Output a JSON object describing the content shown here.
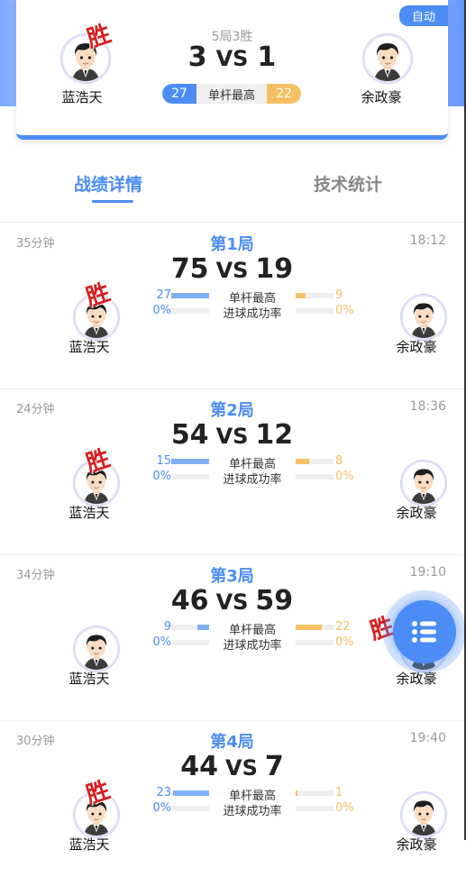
{
  "summary": {
    "auto_label": "自动",
    "rule": "5局3胜",
    "score_left": "3",
    "vs": "VS",
    "score_right": "1",
    "stat_left": "27",
    "stat_label": "单杆最高",
    "stat_right": "22",
    "player_left": "蓝浩天",
    "player_right": "余政豪",
    "win_label": "胜"
  },
  "tabs": [
    {
      "label": "战绩详情",
      "active": true
    },
    {
      "label": "技术统计",
      "active": false
    }
  ],
  "labels": {
    "high_break": "单杆最高",
    "pot_rate": "进球成功率",
    "win": "胜",
    "vs": "VS"
  },
  "games": [
    {
      "duration": "35分钟",
      "title": "第1局",
      "time": "18:12",
      "score_left": "75",
      "score_right": "19",
      "hb_left": "27",
      "hb_right": "9",
      "hb_left_fill": 1.0,
      "hb_right_fill": 0.25,
      "rate_left": "0%",
      "rate_right": "0%",
      "winner": "left",
      "player_left": "蓝浩天",
      "player_right": "余政豪"
    },
    {
      "duration": "24分钟",
      "title": "第2局",
      "time": "18:36",
      "score_left": "54",
      "score_right": "12",
      "hb_left": "15",
      "hb_right": "8",
      "hb_left_fill": 1.0,
      "hb_right_fill": 0.35,
      "rate_left": "0%",
      "rate_right": "0%",
      "winner": "left",
      "player_left": "蓝浩天",
      "player_right": "余政豪"
    },
    {
      "duration": "34分钟",
      "title": "第3局",
      "time": "19:10",
      "score_left": "46",
      "score_right": "59",
      "hb_left": "9",
      "hb_right": "22",
      "hb_left_fill": 0.3,
      "hb_right_fill": 0.7,
      "rate_left": "0%",
      "rate_right": "0%",
      "winner": "right",
      "player_left": "蓝浩天",
      "player_right": "余政豪"
    },
    {
      "duration": "30分钟",
      "title": "第4局",
      "time": "19:40",
      "score_left": "44",
      "score_right": "7",
      "hb_left": "23",
      "hb_right": "1",
      "hb_left_fill": 0.95,
      "hb_right_fill": 0.05,
      "rate_left": "0%",
      "rate_right": "0%",
      "winner": "left",
      "player_left": "蓝浩天",
      "player_right": "余政豪"
    }
  ],
  "fab": {
    "icon": "list-menu-icon"
  }
}
